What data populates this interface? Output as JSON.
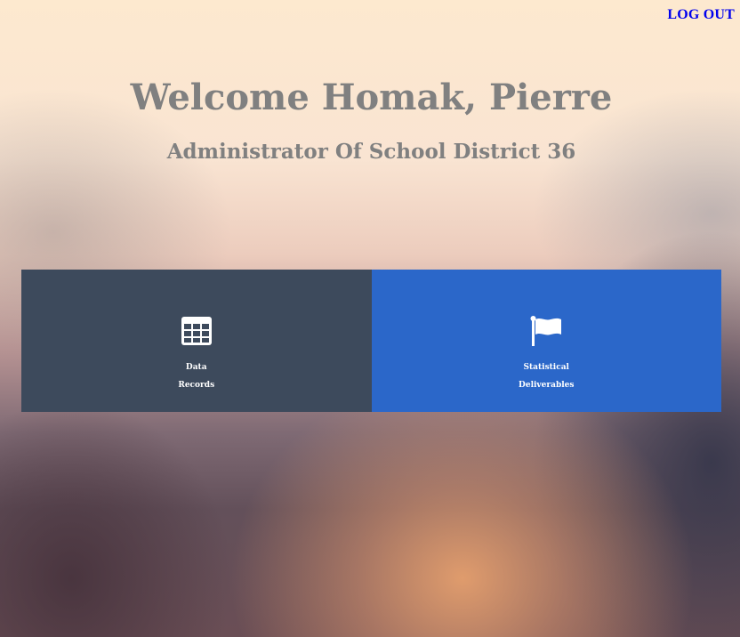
{
  "header": {
    "logout_label": "LOG OUT"
  },
  "main": {
    "welcome": "Welcome Homak, Pierre",
    "role": "Administrator Of School District 36"
  },
  "tiles": [
    {
      "line1": "Data",
      "line2": "Records",
      "icon": "table-icon",
      "color": "#3d4a5c"
    },
    {
      "line1": "Statistical",
      "line2": "Deliverables",
      "icon": "flag-icon",
      "color": "#2b67c9"
    }
  ],
  "colors": {
    "link": "#0000ee",
    "heading": "#808080"
  }
}
